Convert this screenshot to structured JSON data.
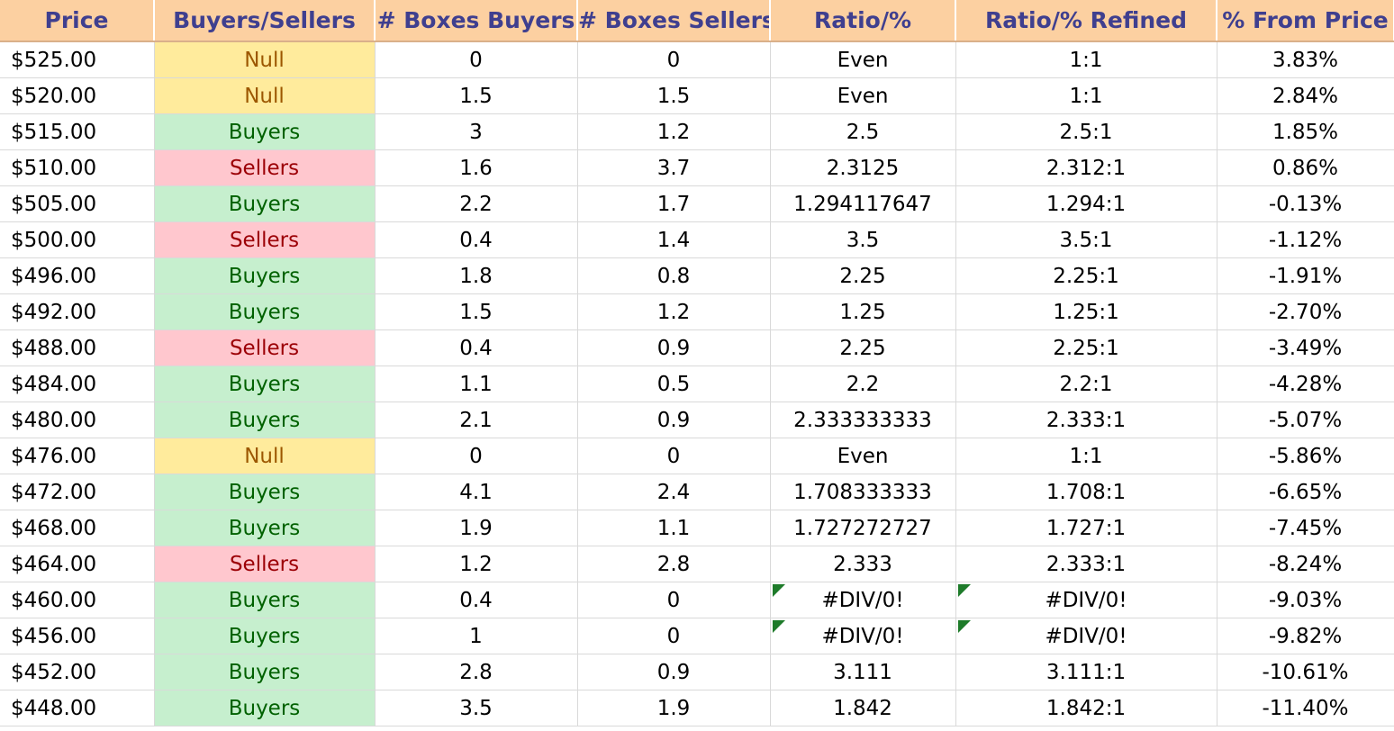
{
  "headers": {
    "price": "Price",
    "buyers_sellers": "Buyers/Sellers",
    "boxes_buyers": "# Boxes Buyers",
    "boxes_sellers": "# Boxes Sellers",
    "ratio": "Ratio/%",
    "ratio_refined": "Ratio/% Refined",
    "from_price": "% From Price"
  },
  "status_colors": {
    "Null": {
      "background": "#ffeb9c",
      "text": "#9c5700"
    },
    "Buyers": {
      "background": "#c6efce",
      "text": "#006100"
    },
    "Sellers": {
      "background": "#ffc7ce",
      "text": "#9c0006"
    }
  },
  "error_indicator_color": "#1e7b2a",
  "rows": [
    {
      "price": "$525.00",
      "side": "Null",
      "boxes_buyers": "0",
      "boxes_sellers": "0",
      "ratio": "Even",
      "ratio_refined": "1:1",
      "from_price": "3.83%",
      "error": false
    },
    {
      "price": "$520.00",
      "side": "Null",
      "boxes_buyers": "1.5",
      "boxes_sellers": "1.5",
      "ratio": "Even",
      "ratio_refined": "1:1",
      "from_price": "2.84%",
      "error": false
    },
    {
      "price": "$515.00",
      "side": "Buyers",
      "boxes_buyers": "3",
      "boxes_sellers": "1.2",
      "ratio": "2.5",
      "ratio_refined": "2.5:1",
      "from_price": "1.85%",
      "error": false
    },
    {
      "price": "$510.00",
      "side": "Sellers",
      "boxes_buyers": "1.6",
      "boxes_sellers": "3.7",
      "ratio": "2.3125",
      "ratio_refined": "2.312:1",
      "from_price": "0.86%",
      "error": false
    },
    {
      "price": "$505.00",
      "side": "Buyers",
      "boxes_buyers": "2.2",
      "boxes_sellers": "1.7",
      "ratio": "1.294117647",
      "ratio_refined": "1.294:1",
      "from_price": "-0.13%",
      "error": false
    },
    {
      "price": "$500.00",
      "side": "Sellers",
      "boxes_buyers": "0.4",
      "boxes_sellers": "1.4",
      "ratio": "3.5",
      "ratio_refined": "3.5:1",
      "from_price": "-1.12%",
      "error": false
    },
    {
      "price": "$496.00",
      "side": "Buyers",
      "boxes_buyers": "1.8",
      "boxes_sellers": "0.8",
      "ratio": "2.25",
      "ratio_refined": "2.25:1",
      "from_price": "-1.91%",
      "error": false
    },
    {
      "price": "$492.00",
      "side": "Buyers",
      "boxes_buyers": "1.5",
      "boxes_sellers": "1.2",
      "ratio": "1.25",
      "ratio_refined": "1.25:1",
      "from_price": "-2.70%",
      "error": false
    },
    {
      "price": "$488.00",
      "side": "Sellers",
      "boxes_buyers": "0.4",
      "boxes_sellers": "0.9",
      "ratio": "2.25",
      "ratio_refined": "2.25:1",
      "from_price": "-3.49%",
      "error": false
    },
    {
      "price": "$484.00",
      "side": "Buyers",
      "boxes_buyers": "1.1",
      "boxes_sellers": "0.5",
      "ratio": "2.2",
      "ratio_refined": "2.2:1",
      "from_price": "-4.28%",
      "error": false
    },
    {
      "price": "$480.00",
      "side": "Buyers",
      "boxes_buyers": "2.1",
      "boxes_sellers": "0.9",
      "ratio": "2.333333333",
      "ratio_refined": "2.333:1",
      "from_price": "-5.07%",
      "error": false
    },
    {
      "price": "$476.00",
      "side": "Null",
      "boxes_buyers": "0",
      "boxes_sellers": "0",
      "ratio": "Even",
      "ratio_refined": "1:1",
      "from_price": "-5.86%",
      "error": false
    },
    {
      "price": "$472.00",
      "side": "Buyers",
      "boxes_buyers": "4.1",
      "boxes_sellers": "2.4",
      "ratio": "1.708333333",
      "ratio_refined": "1.708:1",
      "from_price": "-6.65%",
      "error": false
    },
    {
      "price": "$468.00",
      "side": "Buyers",
      "boxes_buyers": "1.9",
      "boxes_sellers": "1.1",
      "ratio": "1.727272727",
      "ratio_refined": "1.727:1",
      "from_price": "-7.45%",
      "error": false
    },
    {
      "price": "$464.00",
      "side": "Sellers",
      "boxes_buyers": "1.2",
      "boxes_sellers": "2.8",
      "ratio": "2.333",
      "ratio_refined": "2.333:1",
      "from_price": "-8.24%",
      "error": false
    },
    {
      "price": "$460.00",
      "side": "Buyers",
      "boxes_buyers": "0.4",
      "boxes_sellers": "0",
      "ratio": "#DIV/0!",
      "ratio_refined": "#DIV/0!",
      "from_price": "-9.03%",
      "error": true
    },
    {
      "price": "$456.00",
      "side": "Buyers",
      "boxes_buyers": "1",
      "boxes_sellers": "0",
      "ratio": "#DIV/0!",
      "ratio_refined": "#DIV/0!",
      "from_price": "-9.82%",
      "error": true
    },
    {
      "price": "$452.00",
      "side": "Buyers",
      "boxes_buyers": "2.8",
      "boxes_sellers": "0.9",
      "ratio": "3.111",
      "ratio_refined": "3.111:1",
      "from_price": "-10.61%",
      "error": false
    },
    {
      "price": "$448.00",
      "side": "Buyers",
      "boxes_buyers": "3.5",
      "boxes_sellers": "1.9",
      "ratio": "1.842",
      "ratio_refined": "1.842:1",
      "from_price": "-11.40%",
      "error": false
    }
  ]
}
